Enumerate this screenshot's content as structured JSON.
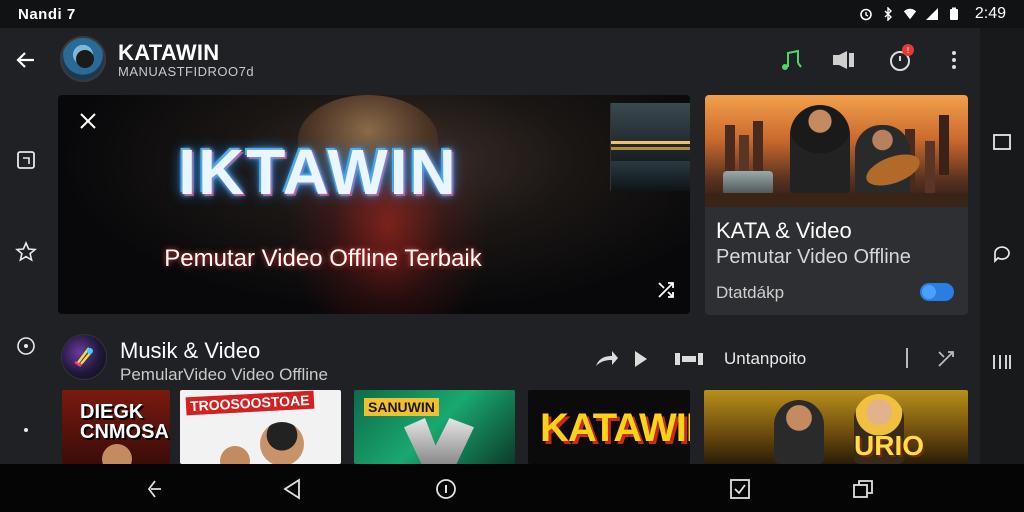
{
  "status_bar": {
    "carrier": "Nandi 7",
    "time": "2:49"
  },
  "header": {
    "channel_title": "KATAWIN",
    "channel_subtitle": "MANUASTFIDROO7d",
    "notification_count": "!"
  },
  "hero": {
    "title": "IKTAWIN",
    "subtitle": "Pemutar Video Offline Terbaik"
  },
  "feature_card": {
    "title": "KATA & Video",
    "subtitle": "Pemutar Video Offline",
    "meta": "Dtatdákp"
  },
  "section": {
    "title": "Musik & Video",
    "subtitle": "PemularVideo Video Offline",
    "label": "Untanpoito"
  },
  "thumbnails": [
    {
      "title": "DIEGK\nCNMOSAIN"
    },
    {
      "title": "TROOSOOSTOAE"
    },
    {
      "title": "SANUWIN"
    },
    {
      "title": "KATAWIN"
    },
    {
      "title": "URIO"
    }
  ],
  "colors": {
    "background": "#202124",
    "accent_green": "#4cd964",
    "notification_red": "#e53935",
    "toggle_blue": "#2a7de1"
  }
}
